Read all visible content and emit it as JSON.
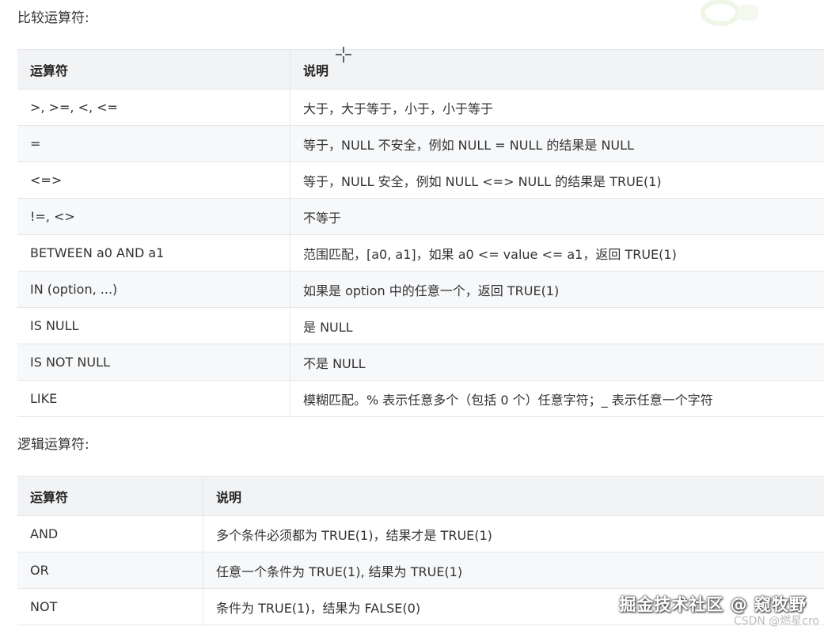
{
  "comparison": {
    "title": "比较运算符:",
    "headers": [
      "运算符",
      "说明"
    ],
    "rows": [
      [
        ">, >=, <, <=",
        "大于，大于等于，小于，小于等于"
      ],
      [
        "=",
        "等于，NULL 不安全，例如 NULL = NULL 的结果是 NULL"
      ],
      [
        "<=>",
        "等于，NULL 安全，例如 NULL <=> NULL 的结果是 TRUE(1)"
      ],
      [
        "!=, <>",
        "不等于"
      ],
      [
        "BETWEEN a0 AND a1",
        "范围匹配，[a0, a1]，如果 a0 <= value <= a1，返回 TRUE(1)"
      ],
      [
        "IN (option, ...)",
        "如果是 option 中的任意一个，返回 TRUE(1)"
      ],
      [
        "IS NULL",
        "是 NULL"
      ],
      [
        "IS NOT NULL",
        "不是 NULL"
      ],
      [
        "LIKE",
        "模糊匹配。% 表示任意多个（包括 0 个）任意字符；_ 表示任意一个字符"
      ]
    ]
  },
  "logical": {
    "title": "逻辑运算符:",
    "headers": [
      "运算符",
      "说明"
    ],
    "rows": [
      [
        "AND",
        "多个条件必须都为 TRUE(1)，结果才是 TRUE(1)"
      ],
      [
        "OR",
        "任意一个条件为 TRUE(1), 结果为 TRUE(1)"
      ],
      [
        "NOT",
        "条件为 TRUE(1)，结果为 FALSE(0)"
      ]
    ]
  },
  "watermark": {
    "main": "掘金技术社区 @ 窥牧野",
    "sub": "CSDN @燃星cro"
  },
  "icons": {
    "cursor": "crosshair-cursor-icon"
  }
}
